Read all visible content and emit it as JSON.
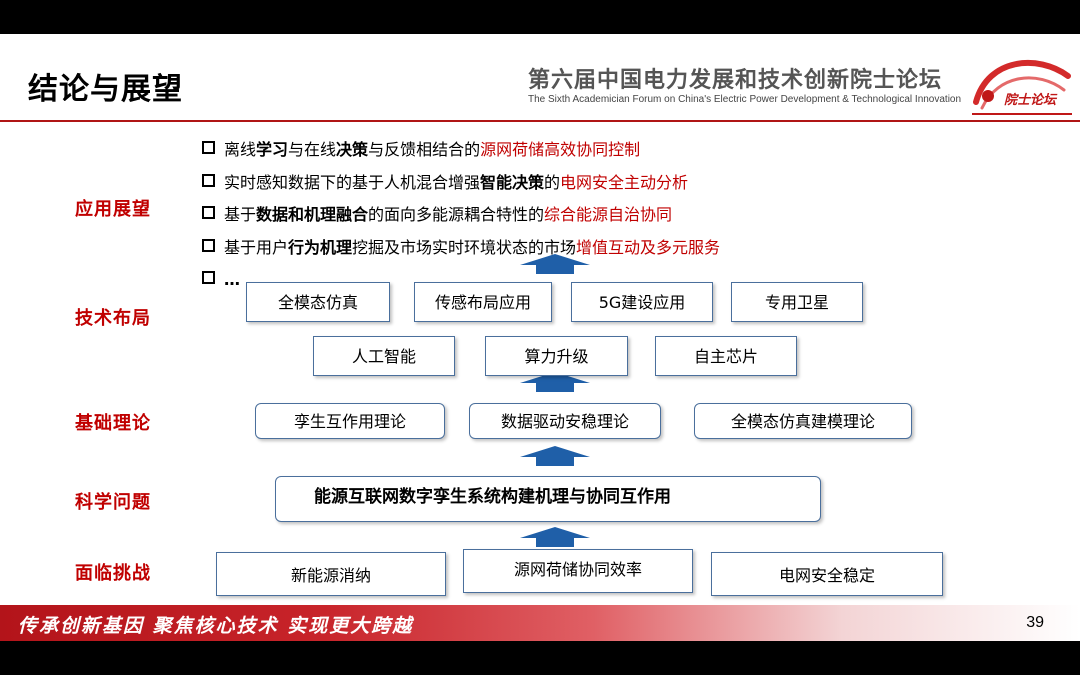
{
  "header": {
    "title": "结论与展望",
    "forum_cn": "第六届中国电力发展和技术创新院士论坛",
    "forum_en": "The Sixth Academician Forum on China's Electric Power Development & Technological Innovation",
    "logo_text": "院士论坛",
    "brand_color": "#c00000"
  },
  "categories": {
    "application": "应用展望",
    "technology": "技术布局",
    "theory": "基础理论",
    "science": "科学问题",
    "challenge": "面临挑战"
  },
  "bullets": {
    "b1": {
      "p1": "离线",
      "p2": "学习",
      "p3": "与在线",
      "p4": "决策",
      "p5": "与反馈相结合的",
      "p6": "源网荷储高效协同控制"
    },
    "b2": {
      "p1": "实时感知数据下的基于人机混合增强",
      "p2": "智能决策",
      "p3": "的",
      "p4": "电网安全主动分析"
    },
    "b3": {
      "p1": "基于",
      "p2": "数据和机理融合",
      "p3": "的面向多能源耦合特性的",
      "p4": "综合能源自治协同"
    },
    "b4": {
      "p1": "基于用户",
      "p2": "行为机理",
      "p3": "挖掘及市场实时环境状态的市场",
      "p4": "增值互动及多元服务"
    },
    "b5": {
      "p1": "…"
    }
  },
  "tech_row1": [
    "全模态仿真",
    "传感布局应用",
    "5G建设应用",
    "专用卫星"
  ],
  "tech_row2": [
    "人工智能",
    "算力升级",
    "自主芯片"
  ],
  "theory_boxes": [
    "孪生互作用理论",
    "数据驱动安稳理论",
    "全模态仿真建模理论"
  ],
  "science_box": "能源互联网数字孪生系统构建机理与协同互作用",
  "challenge_boxes": [
    "新能源消纳",
    "源网荷储协同效率",
    "电网安全稳定"
  ],
  "footer": {
    "slogan": "传承创新基因  聚焦核心技术  实现更大跨越",
    "page_number": "39"
  }
}
